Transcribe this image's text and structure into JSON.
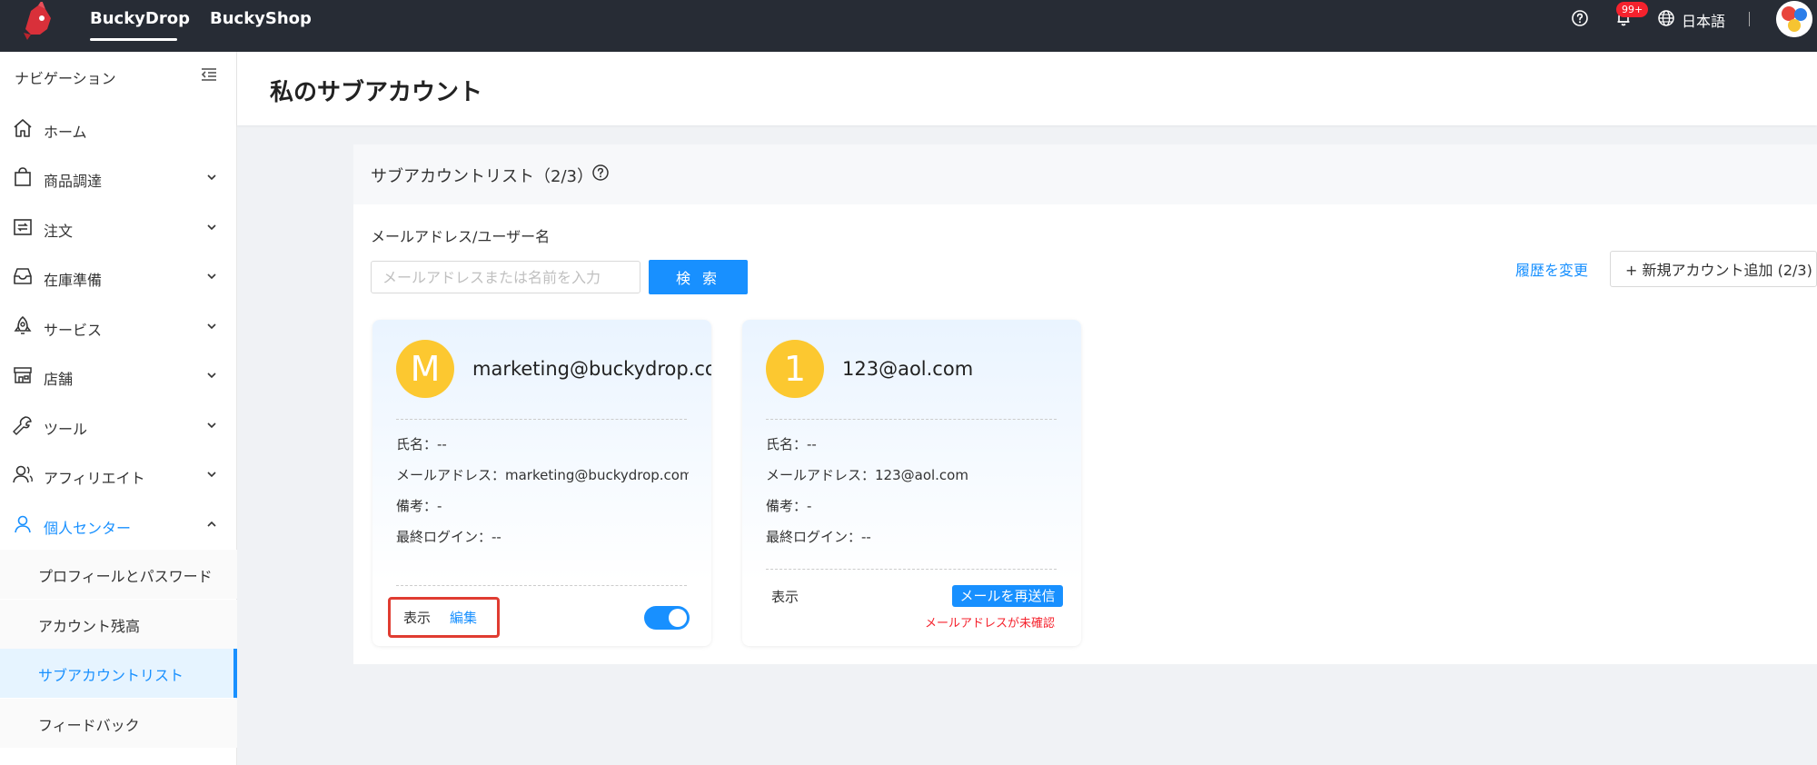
{
  "topbar": {
    "tabs": [
      "BuckyDrop",
      "BuckyShop"
    ],
    "notification_badge": "99+",
    "language": "日本語",
    "icons": [
      "help-icon",
      "bell-icon",
      "globe-icon"
    ]
  },
  "sidebar": {
    "header": "ナビゲーション",
    "items": [
      {
        "label": "ホーム",
        "icon": "home-icon"
      },
      {
        "label": "商品調達",
        "icon": "shopping-bag-icon"
      },
      {
        "label": "注文",
        "icon": "order-icon"
      },
      {
        "label": "在庫準備",
        "icon": "inbox-icon"
      },
      {
        "label": "サービス",
        "icon": "rocket-icon"
      },
      {
        "label": "店舗",
        "icon": "store-icon"
      },
      {
        "label": "ツール",
        "icon": "wrench-icon"
      },
      {
        "label": "アフィリエイト",
        "icon": "affiliate-icon"
      },
      {
        "label": "個人センター",
        "icon": "user-icon"
      }
    ],
    "sub_items": [
      "プロフィールとパスワード",
      "アカウント残高",
      "サブアカウントリスト",
      "フィードバック"
    ],
    "active_sub_item": "サブアカウントリスト"
  },
  "page": {
    "title": "私のサブアカウント"
  },
  "panel": {
    "title": "サブアカウントリスト（2/3）",
    "search_label": "メールアドレス/ユーザー名",
    "search_placeholder": "メールアドレスまたは名前を入力",
    "search_button": "検 索",
    "history_link": "履歴を変更",
    "add_button": "+ 新規アカウント追加 (2/3)"
  },
  "accounts": [
    {
      "initial": "M",
      "email_title": "marketing@buckydrop.com",
      "name_row": "氏名：--",
      "email_row": "メールアドレス：marketing@buckydrop.com",
      "note_row": "備考：-",
      "last_login_row": "最終ログイン：--",
      "view_action": "表示",
      "edit_action": "編集",
      "enabled": true
    },
    {
      "initial": "1",
      "email_title": "123@aol.com",
      "name_row": "氏名：--",
      "email_row": "メールアドレス：123@aol.com",
      "note_row": "備考：-",
      "last_login_row": "最終ログイン：--",
      "view_action": "表示",
      "resend_button": "メールを再送信",
      "status": "メールアドレスが未確認"
    }
  ],
  "colors": {
    "accent": "#1890ff",
    "topbar": "#272c35",
    "avatar": "#fcc830",
    "error": "#f5222d"
  }
}
